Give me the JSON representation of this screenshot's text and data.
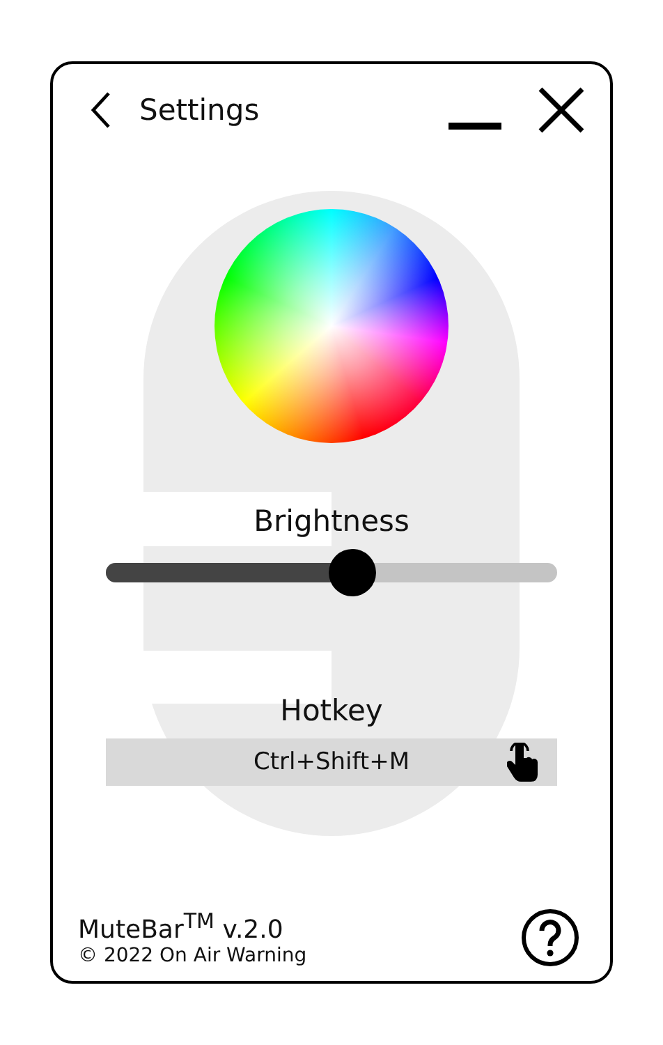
{
  "window": {
    "title": "Settings"
  },
  "brightness": {
    "label": "Brightness",
    "level": 0.545
  },
  "hotkey": {
    "label": "Hotkey",
    "value": "Ctrl+Shift+M"
  },
  "footer": {
    "product": "MuteBar$^{TM}$ v.2.0",
    "copyright": "© 2022 On Air Warning"
  }
}
